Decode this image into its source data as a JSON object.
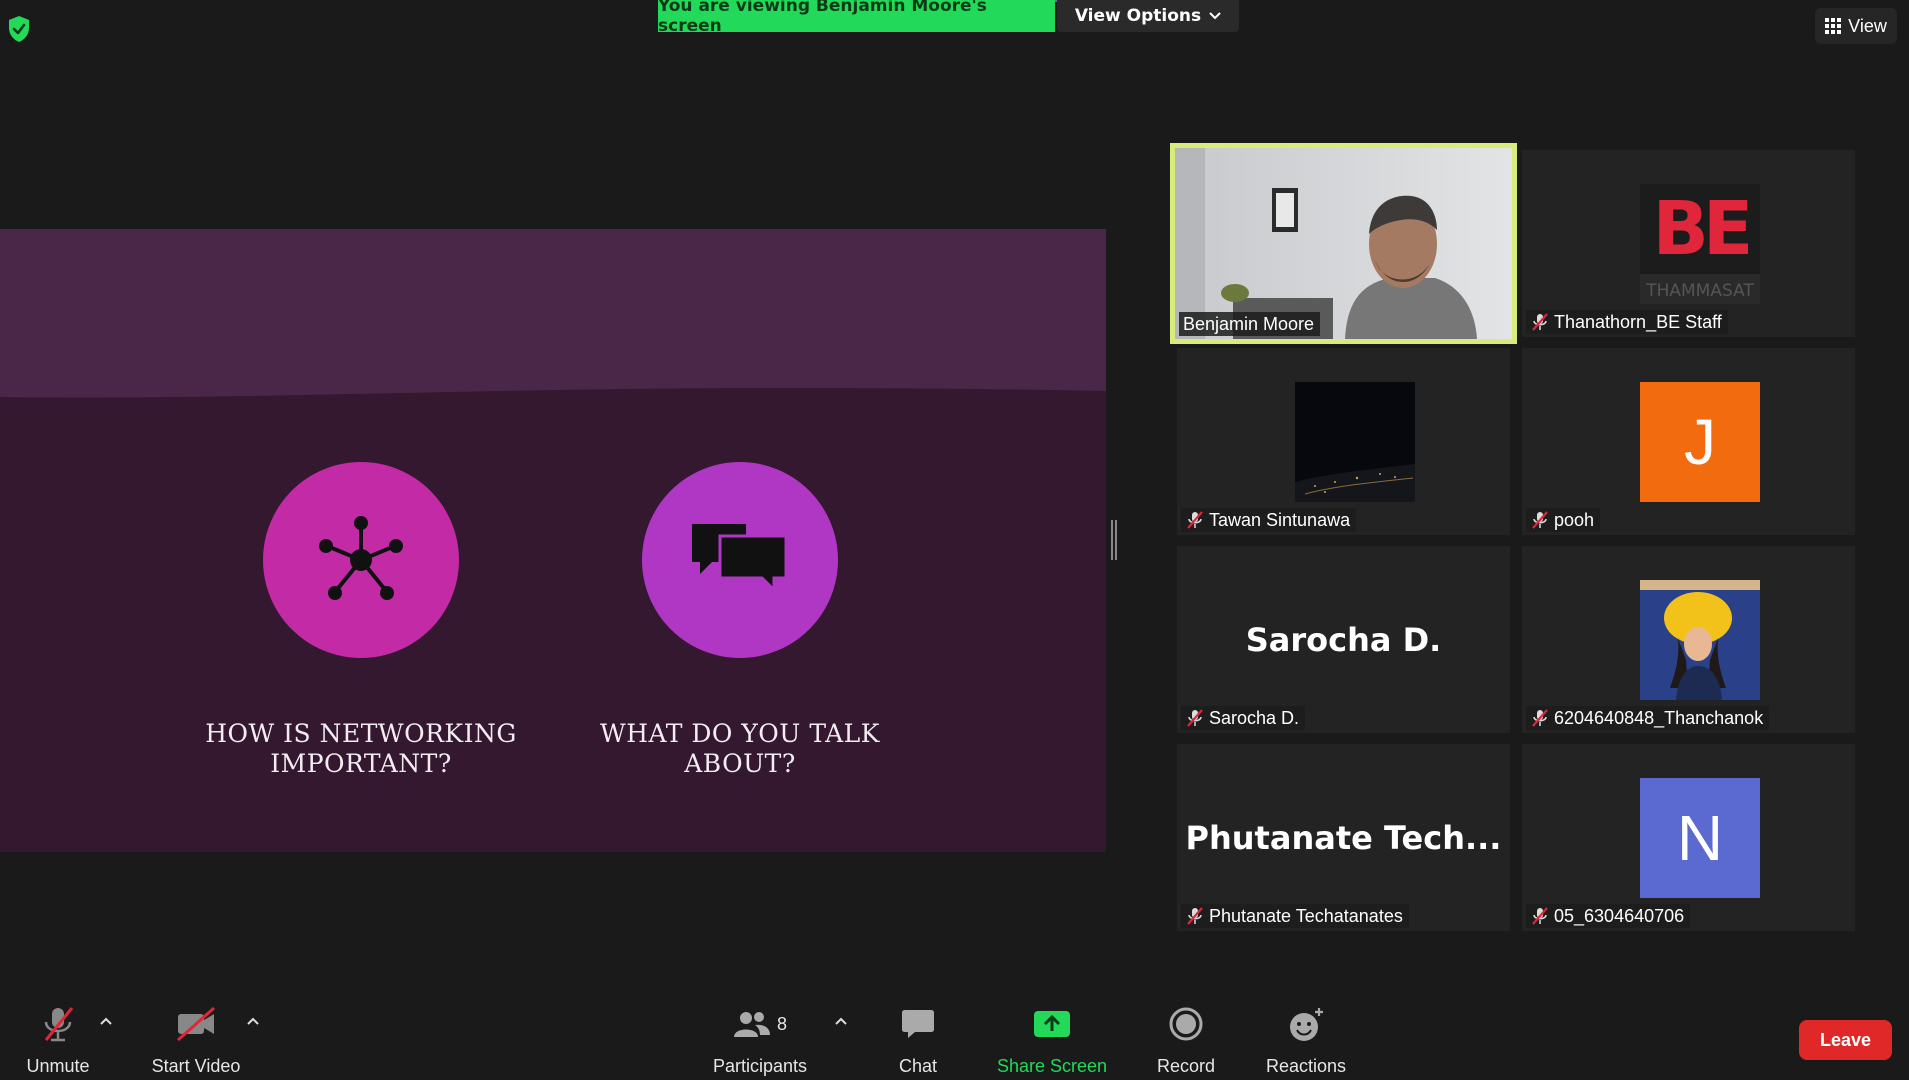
{
  "top": {
    "banner_text": "You are viewing Benjamin Moore's screen",
    "view_options_label": "View Options",
    "view_label": "View"
  },
  "slide": {
    "item1_text": "HOW IS NETWORKING IMPORTANT?",
    "item2_text": "WHAT DO YOU TALK ABOUT?",
    "colors": {
      "background": "#34182f",
      "band": "#4a2748",
      "circle1": "#c22aa6",
      "circle2": "#b036c4"
    }
  },
  "participants": {
    "count": "8",
    "tiles": [
      {
        "name": "Benjamin Moore",
        "type": "video",
        "active_speaker": true,
        "muted": false
      },
      {
        "name": "Thanathorn_BE Staff",
        "type": "logo",
        "logo_text": "THAMMASAT",
        "muted": true
      },
      {
        "name": "Tawan Sintunawa",
        "type": "dark-image",
        "muted": true
      },
      {
        "name": "pooh",
        "type": "initial",
        "initial": "J",
        "color": "#f26b0f",
        "muted": true
      },
      {
        "name": "Sarocha D.",
        "type": "text",
        "display_text": "Sarocha D.",
        "muted": true
      },
      {
        "name": "6204640848_Thanchanok",
        "type": "photo",
        "muted": true
      },
      {
        "name": "Phutanate Techatanates",
        "type": "text",
        "display_text": "Phutanate Tech...",
        "muted": true
      },
      {
        "name": "05_6304640706",
        "type": "initial",
        "initial": "N",
        "color": "#5b6ad0",
        "muted": true
      }
    ]
  },
  "toolbar": {
    "unmute_label": "Unmute",
    "start_video_label": "Start Video",
    "participants_label": "Participants",
    "chat_label": "Chat",
    "share_screen_label": "Share Screen",
    "record_label": "Record",
    "reactions_label": "Reactions",
    "leave_label": "Leave",
    "share_color": "#23d959",
    "leave_color": "#e02828"
  }
}
